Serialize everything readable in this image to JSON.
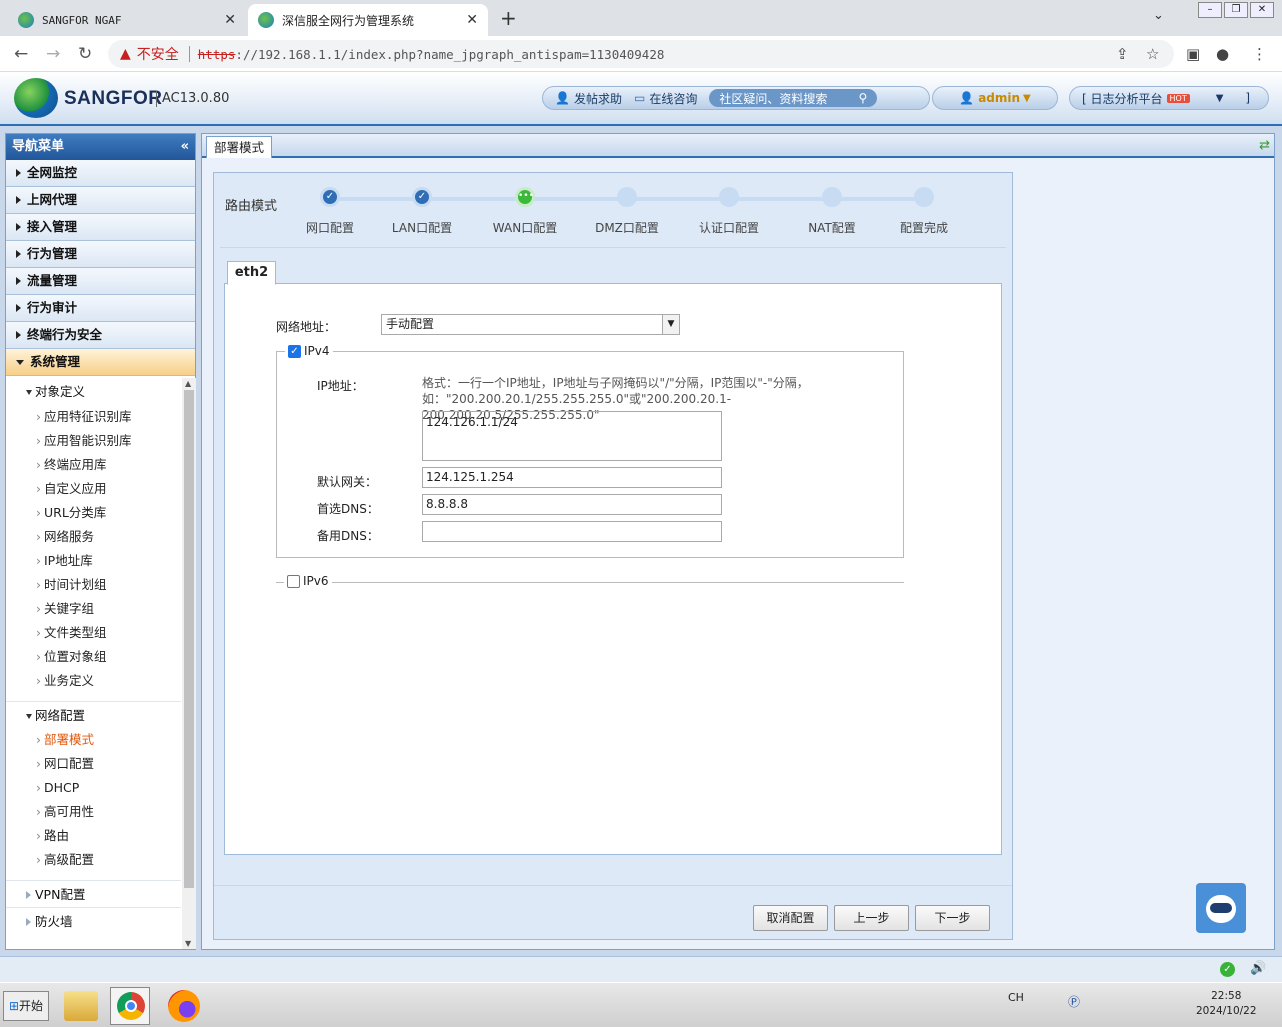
{
  "browser": {
    "tabs": [
      {
        "title": "SANGFOR NGAF",
        "close": "✕"
      },
      {
        "title": "深信服全网行为管理系统",
        "close": "✕"
      }
    ],
    "new_tab": "+",
    "security_label": "不安全",
    "url_scheme": "https",
    "url_rest": "://192.168.1.1/index.php?name_jpgraph_antispam=1130409428"
  },
  "header": {
    "brand": "SANGFOR",
    "version": "AC13.0.80",
    "help_post": "发帖求助",
    "online_consult": "在线咨询",
    "community_search": "社区疑问、资料搜索",
    "user": "admin",
    "log_platform": "[ 日志分析平台",
    "hot_badge": "HOT",
    "log_platform_end": "]"
  },
  "sidebar": {
    "title": "导航菜单",
    "menus": [
      "全网监控",
      "上网代理",
      "接入管理",
      "行为管理",
      "流量管理",
      "行为审计",
      "终端行为安全",
      "系统管理"
    ],
    "groups": [
      {
        "label": "对象定义",
        "items": [
          "应用特征识别库",
          "应用智能识别库",
          "终端应用库",
          "自定义应用",
          "URL分类库",
          "网络服务",
          "IP地址库",
          "时间计划组",
          "关键字组",
          "文件类型组",
          "位置对象组",
          "业务定义"
        ]
      },
      {
        "label": "网络配置",
        "items": [
          "部署模式",
          "网口配置",
          "DHCP",
          "高可用性",
          "路由",
          "高级配置"
        ]
      },
      {
        "label": "VPN配置"
      },
      {
        "label": "防火墙"
      }
    ]
  },
  "content": {
    "tab": "部署模式",
    "mode": "路由模式",
    "steps": [
      "网口配置",
      "LAN口配置",
      "WAN口配置",
      "DMZ口配置",
      "认证口配置",
      "NAT配置",
      "配置完成"
    ],
    "current_step": 3,
    "iface_tab": "eth2",
    "form": {
      "net_addr_label": "网络地址：",
      "net_addr_value": "手动配置",
      "ipv4_label": "IPv4",
      "ipv4_checked": true,
      "ip_label": "IP地址：",
      "format_hint": "格式：一行一个IP地址，IP地址与子网掩码以\"/\"分隔，IP范围以\"-\"分隔，如：\"200.200.20.1/255.255.255.0\"或\"200.200.20.1-200.200.20.5/255.255.255.0\"",
      "ip_value": "124.126.1.1/24",
      "gateway_label": "默认网关：",
      "gateway_value": "124.125.1.254",
      "dns1_label": "首选DNS：",
      "dns1_value": "8.8.8.8",
      "dns2_label": "备用DNS：",
      "dns2_value": "",
      "ipv6_label": "IPv6",
      "ipv6_checked": false
    },
    "buttons": {
      "cancel": "取消配置",
      "prev": "上一步",
      "next": "下一步"
    }
  },
  "taskbar": {
    "start": "开始",
    "tray_lang": "CH",
    "time": "22:58",
    "date": "2024/10/22"
  }
}
